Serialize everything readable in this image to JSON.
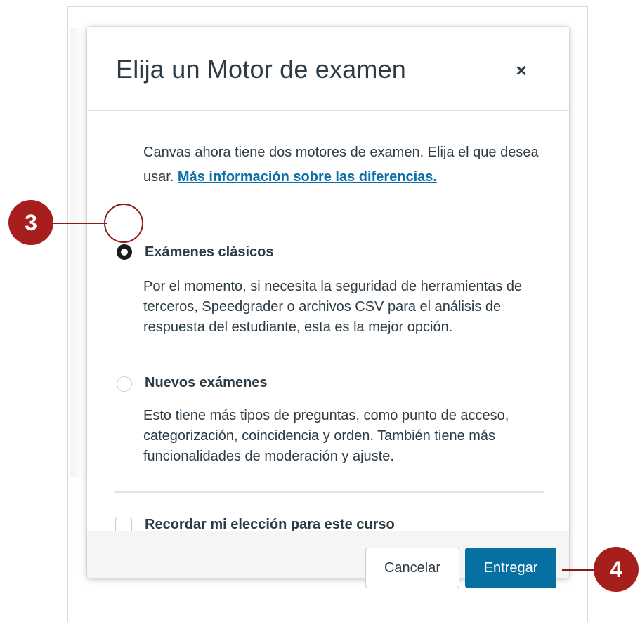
{
  "dialog": {
    "title": "Elija un Motor de examen",
    "close_glyph": "×",
    "intro_text": "Canvas ahora tiene dos motores de examen. Elija el que desea usar.",
    "intro_link": "Más información sobre las diferencias.",
    "options": [
      {
        "label": "Exámenes clásicos",
        "description": "Por el momento, si necesita la seguridad de herramientas de terceros, Speedgrader o archivos CSV para el análisis de respuesta del estudiante, esta es la mejor opción.",
        "selected": true
      },
      {
        "label": "Nuevos exámenes",
        "description": "Esto tiene más tipos de preguntas, como punto de acceso, categorización, coincidencia y orden. También tiene más funcionalidades de moderación y ajuste.",
        "selected": false
      }
    ],
    "remember_label": "Recordar mi elección para este curso",
    "remember_checked": false,
    "cancel_label": "Cancelar",
    "submit_label": "Entregar"
  },
  "callouts": {
    "radio_step": "3",
    "submit_step": "4"
  },
  "colors": {
    "accent": "#0770a3",
    "link": "#0b6fa8",
    "callout": "#a61f1c",
    "text": "#2d3b45"
  }
}
